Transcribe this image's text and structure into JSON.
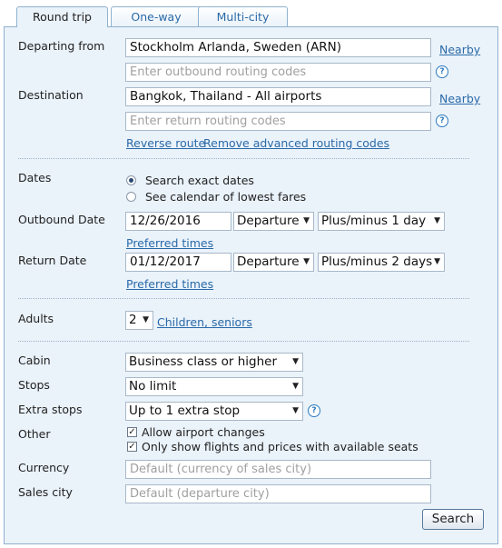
{
  "tabs": [
    "Round trip",
    "One-way",
    "Multi-city"
  ],
  "labels": {
    "departing_from": "Departing from",
    "destination": "Destination",
    "dates": "Dates",
    "outbound_date": "Outbound Date",
    "return_date": "Return Date",
    "adults": "Adults",
    "cabin": "Cabin",
    "stops": "Stops",
    "extra_stops": "Extra stops",
    "other": "Other",
    "currency": "Currency",
    "sales_city": "Sales city"
  },
  "departure": {
    "value": "Stockholm Arlanda, Sweden (ARN)",
    "routing_placeholder": "Enter outbound routing codes",
    "nearby": "Nearby"
  },
  "destination": {
    "value": "Bangkok, Thailand - All airports",
    "routing_placeholder": "Enter return routing codes",
    "nearby": "Nearby"
  },
  "route_links": {
    "reverse": "Reverse route",
    "remove_advanced": "Remove advanced routing codes"
  },
  "date_options": {
    "exact": "Search exact dates",
    "calendar": "See calendar of lowest fares"
  },
  "outbound": {
    "date": "12/26/2016",
    "time_type": "Departure",
    "flex": "Plus/minus 1 day",
    "preferred_times": "Preferred times"
  },
  "return": {
    "date": "01/12/2017",
    "time_type": "Departure",
    "flex": "Plus/minus 2 days",
    "preferred_times": "Preferred times"
  },
  "adults": {
    "count": "2",
    "children_link": "Children, seniors"
  },
  "cabin": "Business class or higher",
  "stops": "No limit",
  "extra_stops": "Up to 1 extra stop",
  "other": {
    "allow_airport_changes": "Allow airport changes",
    "only_available": "Only show flights and prices with available seats"
  },
  "currency_placeholder": "Default (currency of sales city)",
  "sales_city_placeholder": "Default (departure city)",
  "search_button": "Search"
}
